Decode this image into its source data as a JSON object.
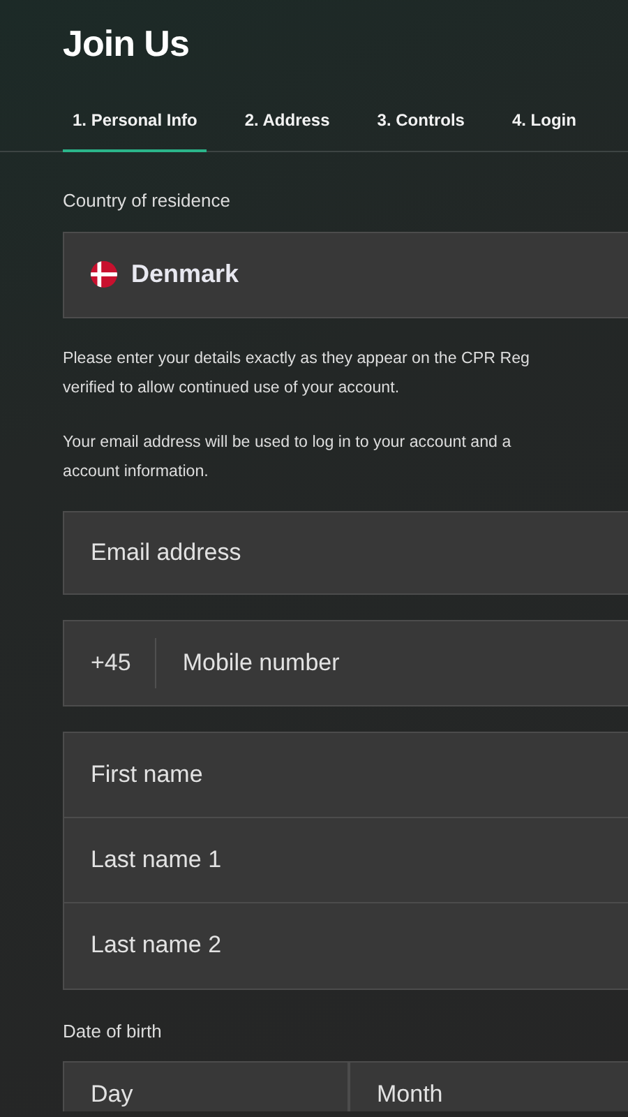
{
  "title": "Join Us",
  "tabs": [
    {
      "label": "1. Personal Info",
      "selected": true
    },
    {
      "label": "2. Address",
      "selected": false
    },
    {
      "label": "3. Controls",
      "selected": false
    },
    {
      "label": "4. Login",
      "selected": false
    }
  ],
  "country": {
    "label": "Country of residence",
    "value": "Denmark"
  },
  "notes": [
    {
      "lines": [
        "Please enter your details exactly as they appear on the CPR Reg",
        "verified to allow continued use of your account."
      ]
    },
    {
      "lines": [
        "Your email address will be used to log in to your account and a",
        "account information."
      ]
    }
  ],
  "email": {
    "placeholder": "Email address"
  },
  "mobile": {
    "prefix": "+45",
    "placeholder": "Mobile number"
  },
  "names": [
    {
      "placeholder": "First name"
    },
    {
      "placeholder": "Last name 1"
    },
    {
      "placeholder": "Last name 2"
    }
  ],
  "birth": {
    "label": "Date of birth",
    "parts": [
      {
        "placeholder": "Day"
      },
      {
        "placeholder": "Month"
      }
    ]
  }
}
